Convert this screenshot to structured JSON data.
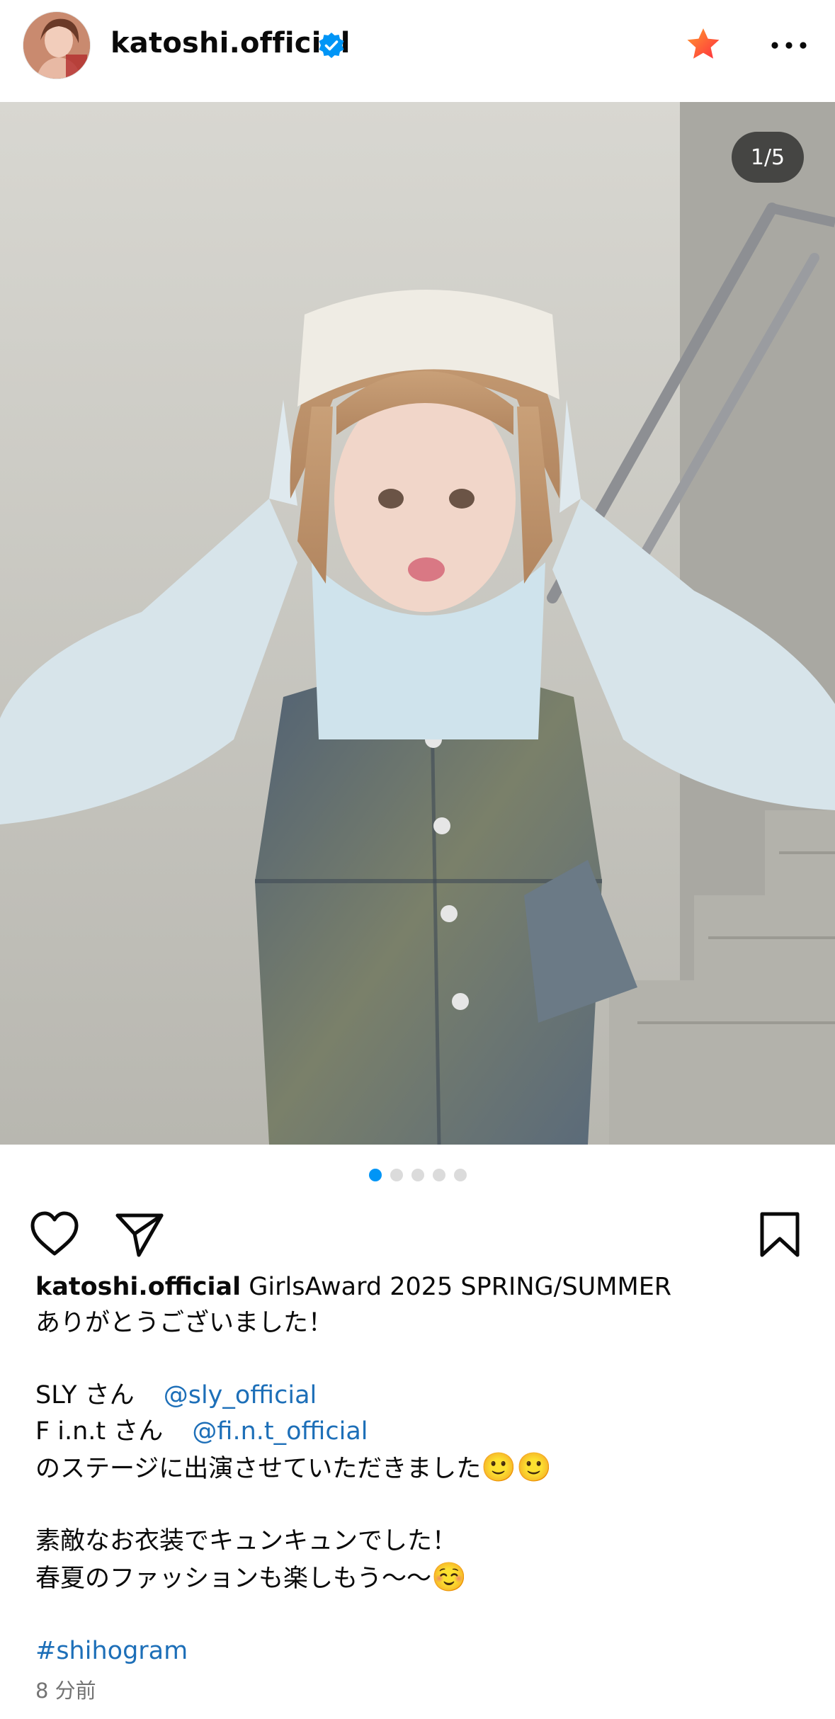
{
  "post": {
    "username": "katoshi.official",
    "counter": "1/5",
    "image_count": 5,
    "active_index": 0,
    "caption": {
      "first_line_text": "GirlsAward 2025 SPRING/SUMMER",
      "line2": "ありがとうございました！",
      "line3_prefix": "SLY さん",
      "line3_mention": "@sly_official",
      "line4_prefix": "F i.n.t さん",
      "line4_mention": "@fi.n.t_official",
      "line5_text": "のステージに出演させていただきました",
      "line5_emoji": "🙂🙂",
      "line6": "素敵なお衣装でキュンキュンでした！",
      "line7_text": "春夏のファッションも楽しもう〜〜",
      "line7_emoji": "☺️",
      "hashtag": "#shihogram"
    },
    "timestamp": "8 分前"
  },
  "icons": {
    "verified": "verified-badge-icon",
    "favorite": "star-icon",
    "more": "more-options-icon",
    "like": "heart-icon",
    "share": "paper-plane-icon",
    "save": "bookmark-icon"
  },
  "colors": {
    "verified_blue": "#0095f6",
    "star_red": "#ff3040",
    "star_orange": "#ff9a2e",
    "link_blue": "#1d6fb8",
    "secondary_text": "#737373"
  }
}
